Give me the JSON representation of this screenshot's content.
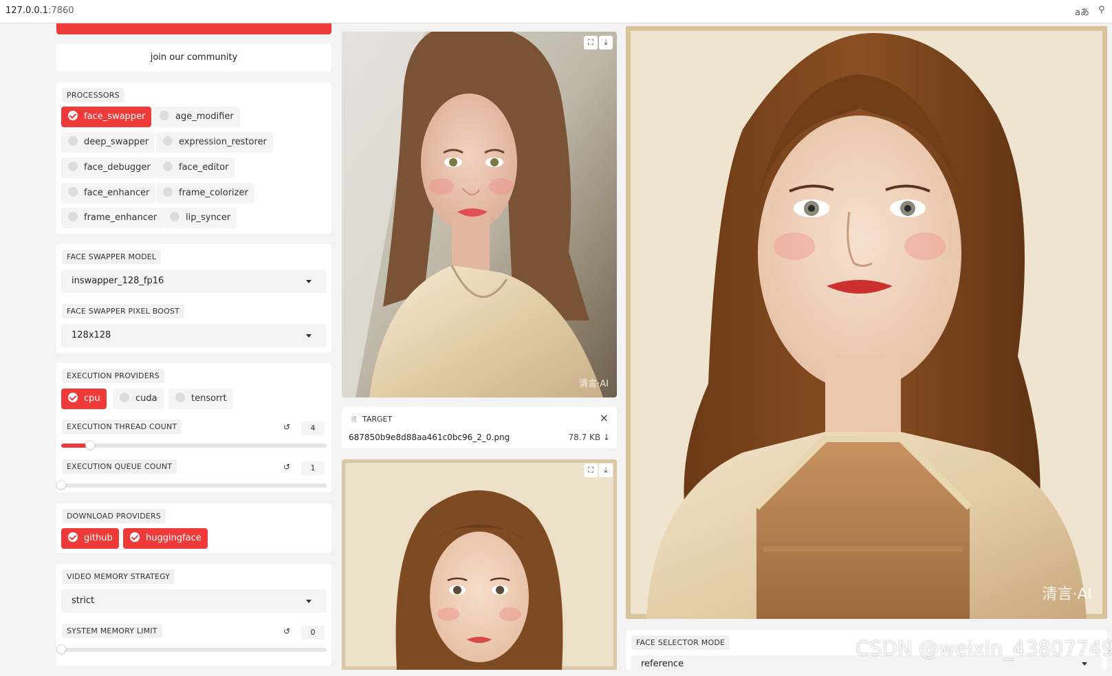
{
  "browser": {
    "url_host": "127.0.0.1",
    "url_port": ":7860",
    "translate_icon": "translate-icon",
    "zoom_icon": "zoom-icon"
  },
  "left": {
    "community_button": "join our community",
    "processors": {
      "label": "PROCESSORS",
      "items": [
        {
          "label": "face_swapper",
          "checked": true
        },
        {
          "label": "age_modifier",
          "checked": false
        },
        {
          "label": "deep_swapper",
          "checked": false
        },
        {
          "label": "expression_restorer",
          "checked": false
        },
        {
          "label": "face_debugger",
          "checked": false
        },
        {
          "label": "face_editor",
          "checked": false
        },
        {
          "label": "face_enhancer",
          "checked": false
        },
        {
          "label": "frame_colorizer",
          "checked": false
        },
        {
          "label": "frame_enhancer",
          "checked": false
        },
        {
          "label": "lip_syncer",
          "checked": false
        }
      ]
    },
    "face_swapper_model": {
      "label": "FACE SWAPPER MODEL",
      "value": "inswapper_128_fp16"
    },
    "face_swapper_pixel_boost": {
      "label": "FACE SWAPPER PIXEL BOOST",
      "value": "128x128"
    },
    "execution_providers": {
      "label": "EXECUTION PROVIDERS",
      "items": [
        {
          "label": "cpu",
          "checked": true
        },
        {
          "label": "cuda",
          "checked": false
        },
        {
          "label": "tensorrt",
          "checked": false
        }
      ]
    },
    "execution_thread_count": {
      "label": "EXECUTION THREAD COUNT",
      "value": "4",
      "fraction": 0.11
    },
    "execution_queue_count": {
      "label": "EXECUTION QUEUE COUNT",
      "value": "1",
      "fraction": 0.0
    },
    "download_providers": {
      "label": "DOWNLOAD PROVIDERS",
      "items": [
        {
          "label": "github",
          "checked": true
        },
        {
          "label": "huggingface",
          "checked": true
        }
      ]
    },
    "video_memory_strategy": {
      "label": "VIDEO MEMORY STRATEGY",
      "value": "strict"
    },
    "system_memory_limit": {
      "label": "SYSTEM MEMORY LIMIT",
      "value": "0",
      "fraction": 0.0
    }
  },
  "middle": {
    "target": {
      "label": "TARGET",
      "filename": "687850b9e8d88aa461c0bc96_2_0.png",
      "size": "78.7 KB ↓"
    },
    "watermark": "清言·AI"
  },
  "right": {
    "watermark": "清言·AI",
    "face_selector_mode": {
      "label": "FACE SELECTOR MODE",
      "value": "reference"
    }
  },
  "overlay_watermark": "CSDN @weixin_43807749",
  "colors": {
    "accent": "#ef3a3a",
    "panel": "#ffffff",
    "background": "#f3f3f3"
  }
}
